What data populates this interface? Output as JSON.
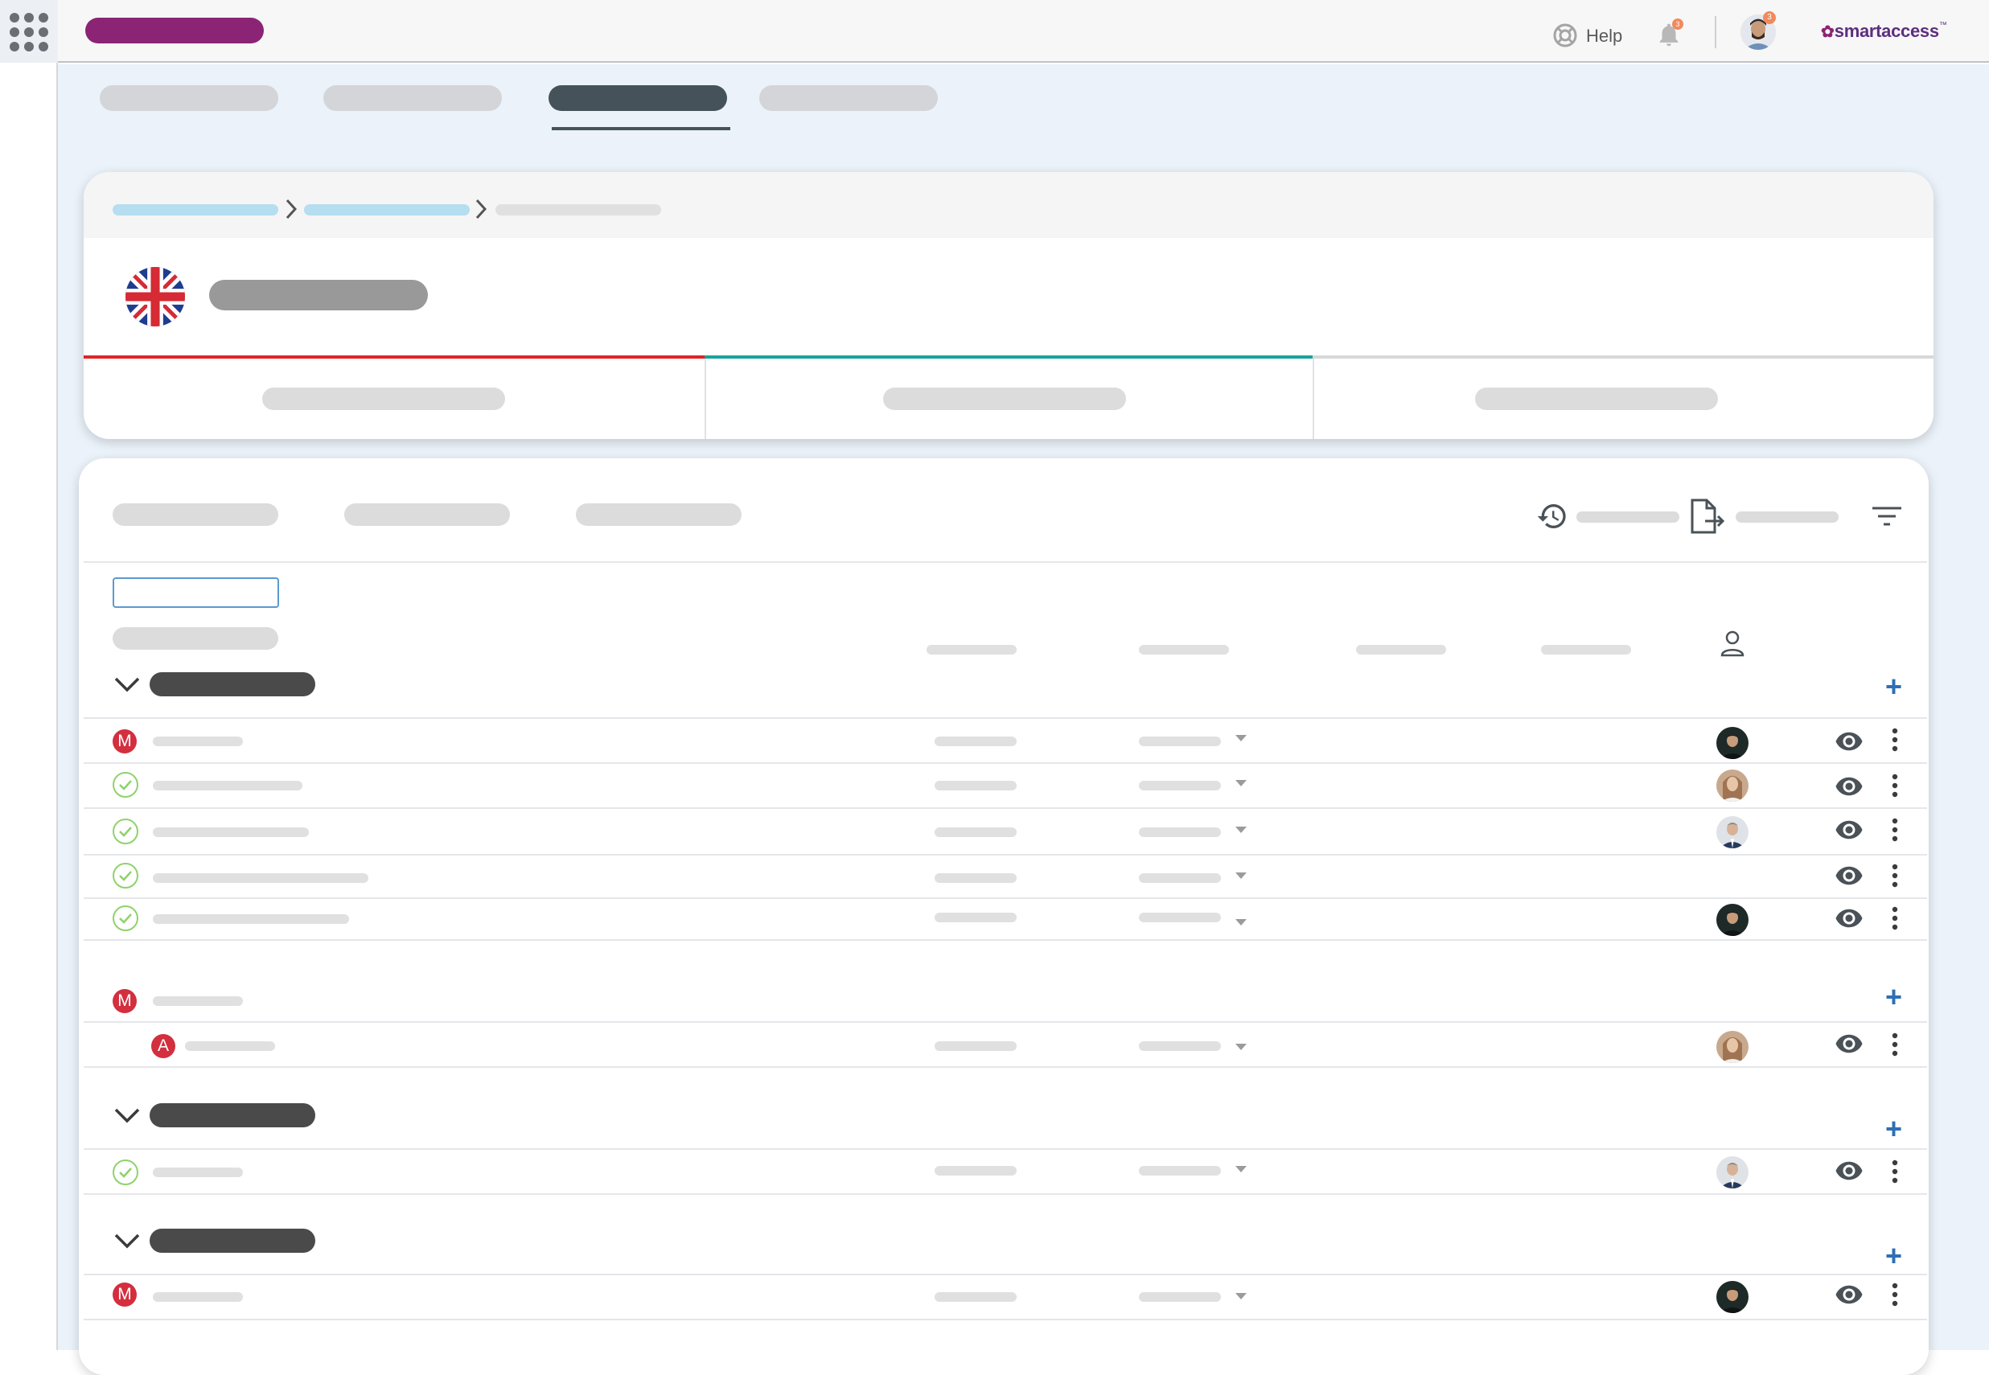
{
  "header": {
    "help_label": "Help",
    "notifications_count": "3",
    "profile_badge_count": "3",
    "brand": "smartaccess",
    "brand_tm": "™"
  },
  "colors": {
    "accent": "#8b2474",
    "teal": "#1ba39c",
    "red": "#e02424",
    "link_blue": "#2d6fb5",
    "check_green": "#8fd26c",
    "badge_red": "#d32f3f"
  },
  "icons": [
    "app-grid-icon",
    "help-icon",
    "bell-icon",
    "user-avatar",
    "history-icon",
    "export-icon",
    "filter-icon",
    "person-icon",
    "chevron-down-icon",
    "plus-icon",
    "eye-icon",
    "more-vert-icon",
    "uk-flag-icon"
  ],
  "sections": [
    {
      "title_visible": false,
      "items": [
        "M",
        "check",
        "check",
        "check",
        "check"
      ]
    },
    {
      "title_visible": false,
      "items": [
        "M",
        "A"
      ]
    },
    {
      "title_visible": false,
      "items": [
        "check"
      ]
    },
    {
      "title_visible": false,
      "items": [
        "M"
      ]
    }
  ],
  "badges": {
    "m_letter": "M",
    "a_letter": "A"
  }
}
